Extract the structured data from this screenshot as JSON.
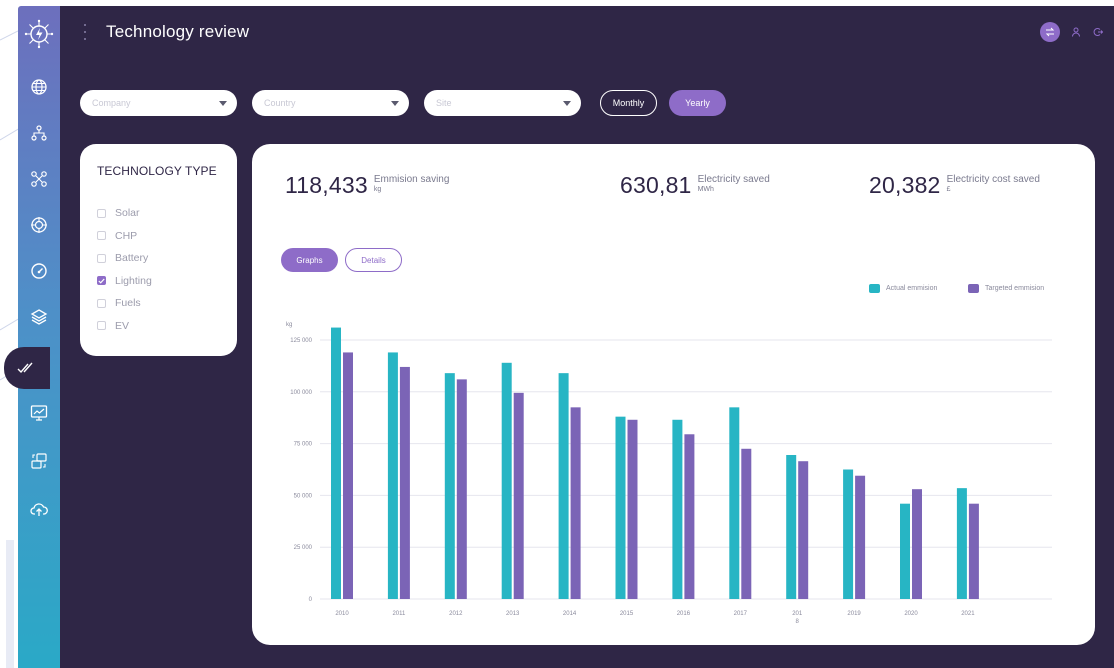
{
  "header": {
    "title": "Technology review"
  },
  "filters": {
    "company_placeholder": "Company",
    "country_placeholder": "Country",
    "site_placeholder": "Site",
    "monthly_label": "Monthly",
    "yearly_label": "Yearly"
  },
  "technology": {
    "title": "TECHNOLOGY TYPE",
    "items": [
      {
        "label": "Solar",
        "checked": false
      },
      {
        "label": "CHP",
        "checked": false
      },
      {
        "label": "Battery",
        "checked": false
      },
      {
        "label": "Lighting",
        "checked": true
      },
      {
        "label": "Fuels",
        "checked": false
      },
      {
        "label": "EV",
        "checked": false
      }
    ]
  },
  "stats": [
    {
      "value": "118,433",
      "label": "Emmision saving",
      "unit": "kg"
    },
    {
      "value": "630,81",
      "label": "Electricity saved",
      "unit": "MWh"
    },
    {
      "value": "20,382",
      "label": "Electricity cost saved",
      "unit": "£"
    }
  ],
  "tabs": {
    "graphs_label": "Graphs",
    "details_label": "Details"
  },
  "colors": {
    "actual": "#27b5c4",
    "target": "#7b64b6",
    "accent": "#8e6cc8",
    "background": "#2f2646"
  },
  "icons": [
    "logo-icon",
    "globe-icon",
    "hierarchy-icon",
    "network-icon",
    "target-icon",
    "gauge-icon",
    "layers-icon",
    "checkmark-icon",
    "monitor-chart-icon",
    "transfer-icon",
    "cloud-upload-icon"
  ],
  "chart_data": {
    "type": "bar",
    "ylabel": "kg",
    "ylim": [
      0,
      125000
    ],
    "yticks": [
      0,
      25000,
      50000,
      75000,
      100000,
      125000
    ],
    "ytick_labels": [
      "0",
      "25 000",
      "50 000",
      "75 000",
      "100 000",
      "125 000"
    ],
    "categories": [
      "2010",
      "2011",
      "2012",
      "2013",
      "2014",
      "2015",
      "2016",
      "2017",
      "2018",
      "2019",
      "2020",
      "2021"
    ],
    "category_labels": [
      "2010",
      "2011",
      "2012",
      "2013",
      "2014",
      "2015",
      "2016",
      "2017",
      "201\n8",
      "2019",
      "2020",
      "2021"
    ],
    "series": [
      {
        "name": "Actual emmision",
        "values": [
          131000,
          119000,
          109000,
          114000,
          109000,
          88000,
          86500,
          92500,
          69500,
          62500,
          46000,
          53500
        ]
      },
      {
        "name": "Targeted emmision",
        "values": [
          119000,
          112000,
          106000,
          99500,
          92500,
          86500,
          79500,
          72500,
          66500,
          59500,
          53000,
          46000
        ]
      }
    ],
    "grid": true,
    "legend": "top-right"
  }
}
